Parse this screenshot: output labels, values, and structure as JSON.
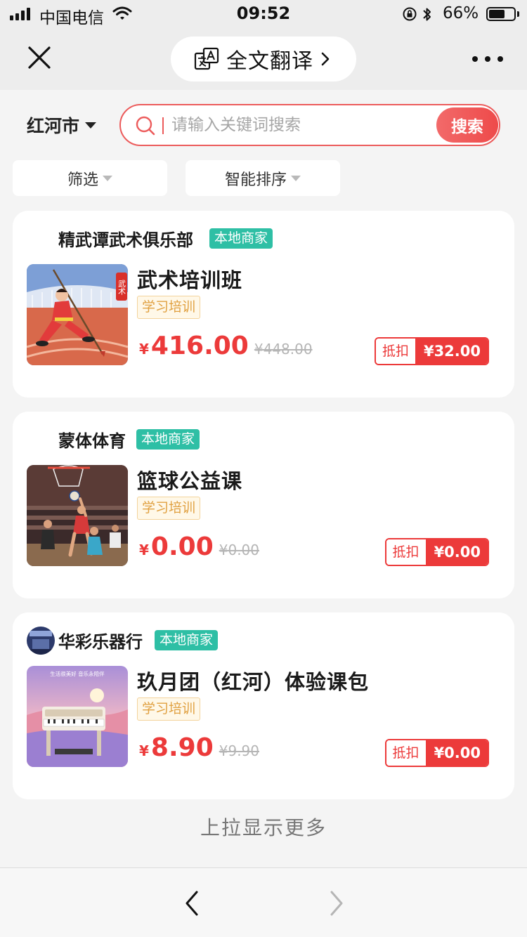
{
  "status_bar": {
    "carrier": "中国电信",
    "time": "09:52",
    "battery_percent": "66%",
    "battery_level": 0.66,
    "icons": [
      "signal-icon",
      "wifi-icon",
      "rotation-lock-icon",
      "bluetooth-icon",
      "battery-icon"
    ]
  },
  "nav": {
    "translate_label": "全文翻译",
    "icons": [
      "close-icon",
      "translate-icon",
      "chevron-right-icon",
      "more-icon"
    ]
  },
  "search": {
    "city": "红河市",
    "placeholder": "请输入关键词搜索",
    "value": "",
    "button_label": "搜索"
  },
  "filters": [
    {
      "label": "筛选"
    },
    {
      "label": "智能排序"
    }
  ],
  "items": [
    {
      "merchant": "精武谭武术俱乐部",
      "badge": "本地商家",
      "title": "武术培训班",
      "category": "学习培训",
      "currency": "¥",
      "price": "416.00",
      "original_price": "¥448.00",
      "deduct_label": "抵扣",
      "deduct_amount": "¥32.00",
      "thumb_text": "武术"
    },
    {
      "merchant": "蒙体体育",
      "badge": "本地商家",
      "title": "篮球公益课",
      "category": "学习培训",
      "currency": "¥",
      "price": "0.00",
      "original_price": "¥0.00",
      "deduct_label": "抵扣",
      "deduct_amount": "¥0.00"
    },
    {
      "merchant": "华彩乐器行",
      "badge": "本地商家",
      "title": "玖月团（红河）体验课包",
      "category": "学习培训",
      "currency": "¥",
      "price": "8.90",
      "original_price": "¥9.90",
      "deduct_label": "抵扣",
      "deduct_amount": "¥0.00",
      "thumb_text": "生活很美好 音乐永陪伴"
    }
  ],
  "load_more": "上拉显示更多",
  "colors": {
    "accent": "#ec3a3a",
    "badge": "#2ebfa5",
    "tag_text": "#e0a040"
  }
}
